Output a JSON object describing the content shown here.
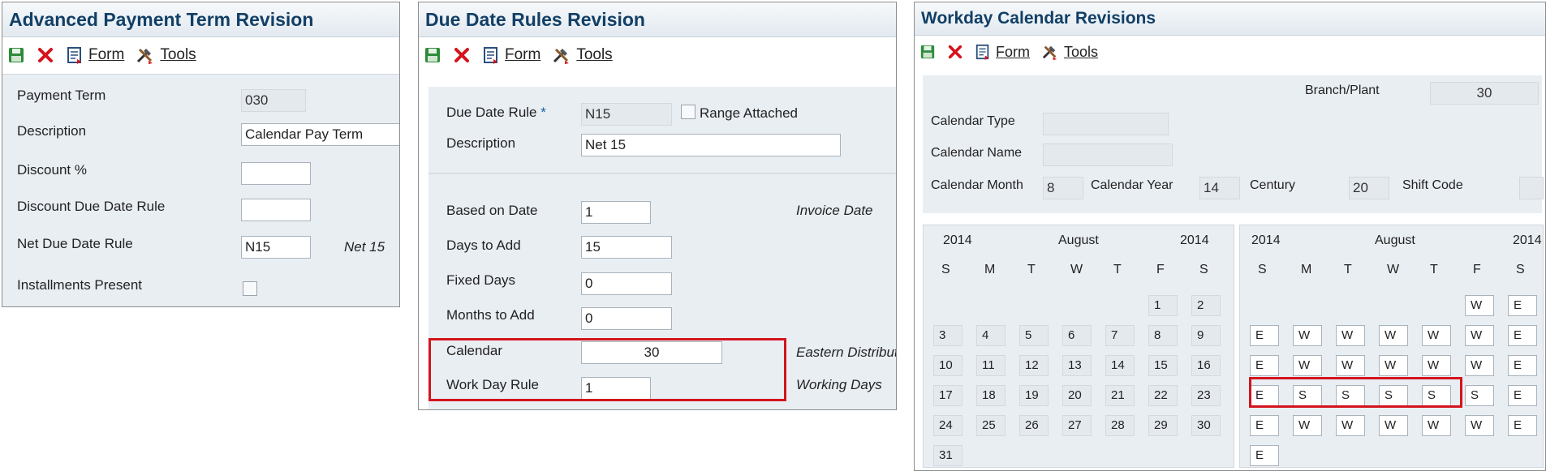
{
  "colors": {
    "title": "#123f66",
    "panel_bg": "#e9eef3",
    "highlight": "#d4141c"
  },
  "toolbar": {
    "form_label": "Form",
    "tools_label": "Tools",
    "form_icon": "form-icon",
    "tools_icon": "tools-icon",
    "save_icon": "save-icon",
    "cancel_icon": "cancel-icon"
  },
  "panel1": {
    "title": "Advanced Payment Term Revision",
    "payment_term_label": "Payment Term",
    "payment_term_value": "030",
    "description_label": "Description",
    "description_value": "Calendar Pay Term",
    "discount_label": "Discount %",
    "discount_value": "",
    "discount_rule_label": "Discount Due Date Rule",
    "discount_rule_value": "",
    "net_rule_label": "Net Due Date Rule",
    "net_rule_value": "N15",
    "net_rule_desc": "Net 15",
    "installments_label": "Installments Present"
  },
  "panel2": {
    "title": "Due Date Rules Revision",
    "rule_label": "Due Date Rule",
    "required_mark": "*",
    "rule_value": "N15",
    "range_label": "Range Attached",
    "description_label": "Description",
    "description_value": "Net 15",
    "based_label": "Based on Date",
    "based_value": "1",
    "based_desc": "Invoice Date",
    "days_label": "Days to Add",
    "days_value": "15",
    "fixed_label": "Fixed Days",
    "fixed_value": "0",
    "months_label": "Months to Add",
    "months_value": "0",
    "calendar_label": "Calendar",
    "calendar_value": "30",
    "calendar_desc": "Eastern Distributi",
    "workday_label": "Work Day Rule",
    "workday_value": "1",
    "workday_desc": "Working Days"
  },
  "panel3": {
    "title": "Workday Calendar Revisions",
    "branch_label": "Branch/Plant",
    "branch_value": "30",
    "type_label": "Calendar Type",
    "type_value": "",
    "name_label": "Calendar Name",
    "name_value": "",
    "month_label": "Calendar Month",
    "month_value": "8",
    "year_label": "Calendar Year",
    "year_value": "14",
    "century_label": "Century",
    "century_value": "20",
    "shift_label": "Shift Code",
    "shift_value": "",
    "left_cal": {
      "year_left": "2014",
      "month": "August",
      "year_right": "2014",
      "weekdays": [
        "S",
        "M",
        "T",
        "W",
        "T",
        "F",
        "S"
      ],
      "weeks": [
        [
          "",
          "",
          "",
          "",
          "",
          "1",
          "2"
        ],
        [
          "3",
          "4",
          "5",
          "6",
          "7",
          "8",
          "9"
        ],
        [
          "10",
          "11",
          "12",
          "13",
          "14",
          "15",
          "16"
        ],
        [
          "17",
          "18",
          "19",
          "20",
          "21",
          "22",
          "23"
        ],
        [
          "24",
          "25",
          "26",
          "27",
          "28",
          "29",
          "30"
        ],
        [
          "31",
          "",
          "",
          "",
          "",
          "",
          ""
        ]
      ]
    },
    "right_cal": {
      "year_left": "2014",
      "month": "August",
      "year_right": "2014",
      "weekdays": [
        "S",
        "M",
        "T",
        "W",
        "T",
        "F",
        "S"
      ],
      "weeks": [
        [
          "",
          "",
          "",
          "",
          "",
          "W",
          "E"
        ],
        [
          "E",
          "W",
          "W",
          "W",
          "W",
          "W",
          "E"
        ],
        [
          "E",
          "W",
          "W",
          "W",
          "W",
          "W",
          "E"
        ],
        [
          "E",
          "S",
          "S",
          "S",
          "S",
          "S",
          "E"
        ],
        [
          "E",
          "W",
          "W",
          "W",
          "W",
          "W",
          "E"
        ],
        [
          "E",
          "",
          "",
          "",
          "",
          "",
          ""
        ]
      ]
    }
  }
}
